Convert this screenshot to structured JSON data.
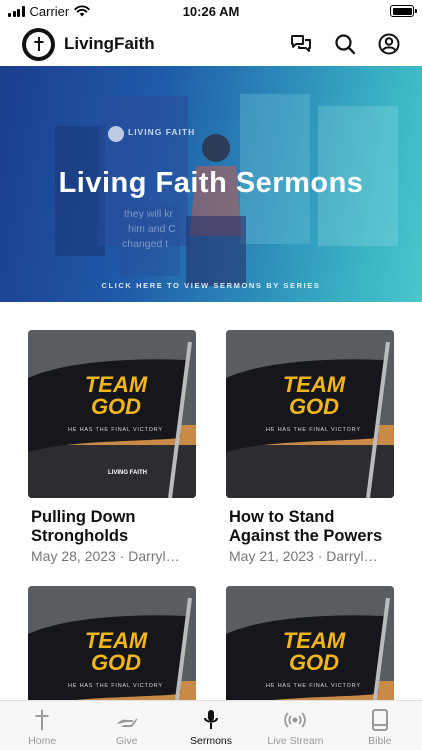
{
  "status_bar": {
    "carrier": "Carrier",
    "time": "10:26 AM"
  },
  "header": {
    "app_name": "LivingFaith",
    "icons": [
      "chat-icon",
      "search-icon",
      "profile-icon"
    ]
  },
  "hero": {
    "title": "Living Faith Sermons",
    "subtitle": "CLICK HERE TO VIEW SERMONS BY SERIES",
    "podium_logo_text": "LIVING FAITH",
    "background_screen_text": [
      "they will kr",
      "him and C",
      "changed t"
    ]
  },
  "sermons": [
    {
      "title": "Pulling Down Strongholds",
      "meta": "May 28, 2023 · Darryl…",
      "thumb_title": "TEAM GOD",
      "thumb_tagline": "HE HAS THE FINAL VICTORY",
      "thumb_logo": "LIVING FAITH"
    },
    {
      "title": "How to Stand Against the Powers",
      "meta": "May 21, 2023 · Darryl…",
      "thumb_title": "TEAM GOD",
      "thumb_tagline": "HE HAS THE FINAL VICTORY",
      "thumb_logo": ""
    },
    {
      "title": "",
      "meta": "",
      "thumb_title": "TEAM GOD",
      "thumb_tagline": "HE HAS THE FINAL VICTORY",
      "thumb_logo": ""
    },
    {
      "title": "",
      "meta": "",
      "thumb_title": "TEAM GOD",
      "thumb_tagline": "HE HAS THE FINAL VICTORY",
      "thumb_logo": ""
    }
  ],
  "tabbar": [
    {
      "label": "Home",
      "icon": "cross-icon",
      "active": false
    },
    {
      "label": "Give",
      "icon": "hand-icon",
      "active": false
    },
    {
      "label": "Sermons",
      "icon": "microphone-icon",
      "active": true
    },
    {
      "label": "Live Stream",
      "icon": "broadcast-icon",
      "active": false
    },
    {
      "label": "Bible",
      "icon": "book-icon",
      "active": false
    }
  ],
  "colors": {
    "accent": "#111111",
    "inactive": "#9a9a9a",
    "hero_start": "#1c3d8e",
    "hero_end": "#4ac6cc",
    "thumb_gold": "#f2b51c"
  }
}
